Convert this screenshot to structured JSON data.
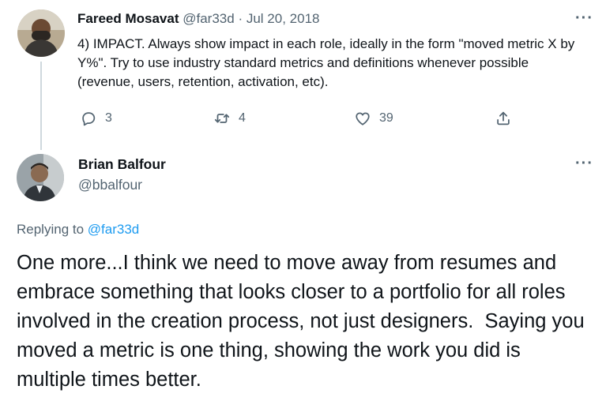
{
  "parent_tweet": {
    "author_name": "Fareed Mosavat",
    "handle": "@far33d",
    "separator": "·",
    "date": "Jul 20, 2018",
    "text": "4) IMPACT. Always show impact in each role, ideally in the form \"moved metric X by Y%\". Try to use industry standard metrics and definitions whenever possible (revenue, users, retention, activation, etc).",
    "more_label": "···",
    "actions": {
      "reply_count": "3",
      "retweet_count": "4",
      "like_count": "39"
    }
  },
  "main_tweet": {
    "author_name": "Brian Balfour",
    "handle": "@bbalfour",
    "more_label": "···",
    "replying_prefix": "Replying to",
    "replying_mention": "@far33d",
    "text": "One more...I think we need to move away from resumes and embrace something that looks closer to a portfolio for all roles involved in the creation process, not just designers.  Saying you moved a metric is one thing, showing the work you did is multiple times better."
  },
  "icons": {
    "reply": "reply-icon",
    "retweet": "retweet-icon",
    "like": "like-icon",
    "share": "share-icon",
    "more": "more-icon"
  },
  "colors": {
    "text": "#0f1419",
    "muted": "#536471",
    "link": "#1d9bf0",
    "thread_line": "#cfd9de"
  }
}
